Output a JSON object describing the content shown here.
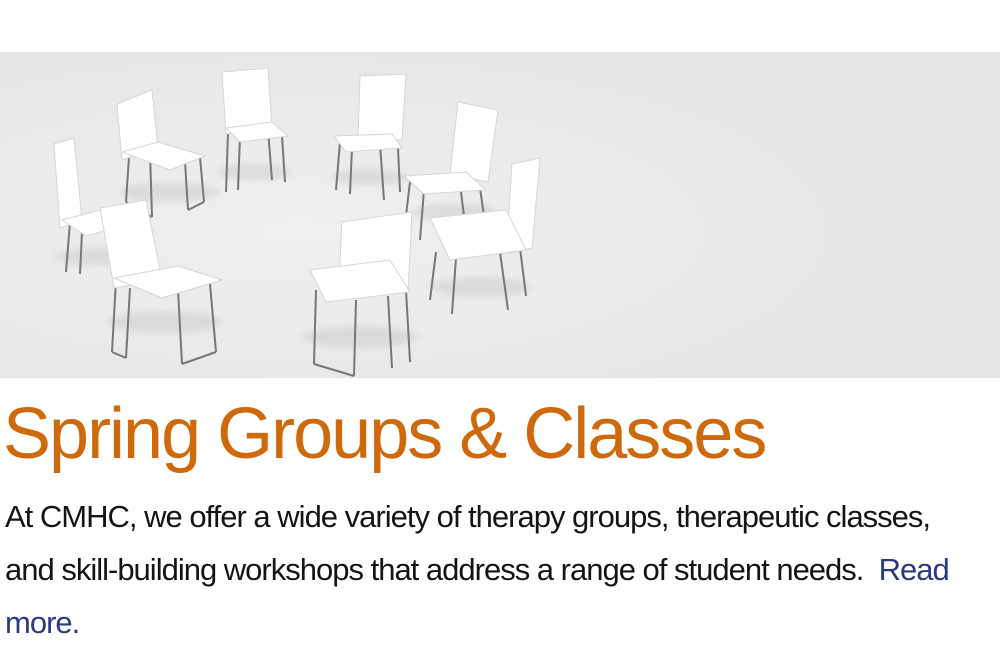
{
  "hero": {
    "image_icon": "circle-of-chairs-photo"
  },
  "article": {
    "title": "Spring Groups & Classes",
    "body": "At CMHC, we offer a wide variety of therapy groups, therapeutic classes, and skill-building workshops that address a range of student needs.",
    "link_label": "Read more."
  },
  "colors": {
    "title": "#cf6a0c",
    "link": "#2d3a80",
    "body": "#141414",
    "hero_background": "#e8e8e8"
  }
}
